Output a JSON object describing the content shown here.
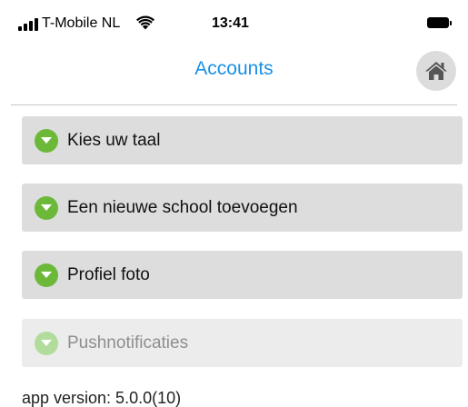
{
  "status_bar": {
    "carrier": "T-Mobile NL",
    "time": "13:41",
    "icons": [
      "signal-icon",
      "wifi-icon",
      "battery-icon"
    ]
  },
  "header": {
    "title": "Accounts",
    "home_icon": "home-icon"
  },
  "menu": {
    "items": [
      {
        "label": "Kies uw taal",
        "enabled": true,
        "icon": "chevron-down-icon"
      },
      {
        "label": "Een nieuwe school toevoegen",
        "enabled": true,
        "icon": "chevron-down-icon"
      },
      {
        "label": "Profiel foto",
        "enabled": true,
        "icon": "chevron-down-icon"
      },
      {
        "label": "Pushnotificaties",
        "enabled": false,
        "icon": "chevron-down-icon"
      }
    ]
  },
  "footer": {
    "version_text": "app version: 5.0.0(10)"
  },
  "colors": {
    "title": "#1a90e6",
    "menu_bg": "#dddddd",
    "menu_bg_disabled": "#ececec",
    "icon_green": "#6cb93a",
    "icon_green_disabled": "#b2dc9b"
  }
}
